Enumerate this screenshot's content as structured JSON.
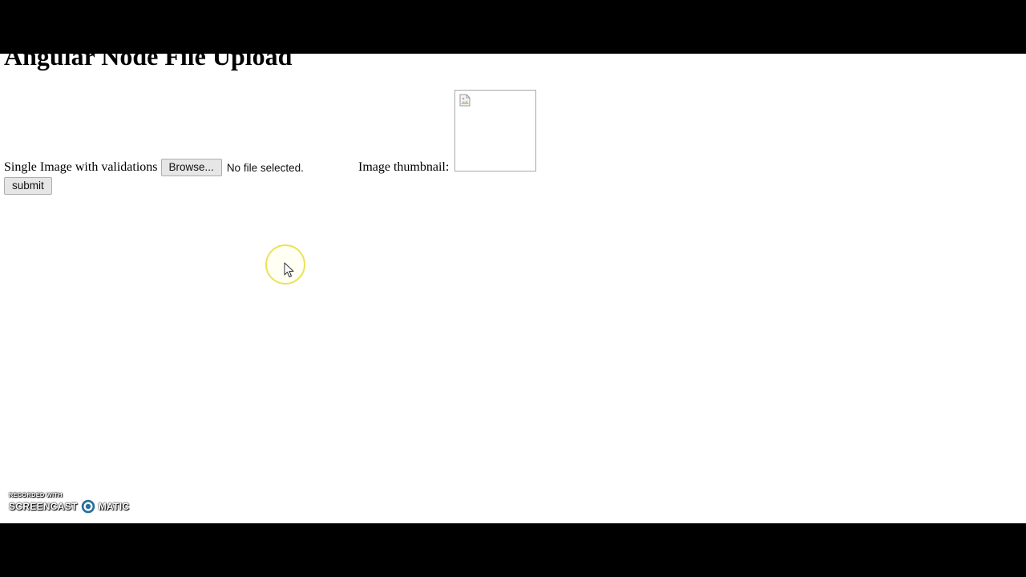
{
  "page": {
    "title": "Angular Node File Upload"
  },
  "upload": {
    "label": "Single Image with validations",
    "browse_label": "Browse...",
    "file_status": "No file selected."
  },
  "thumbnail": {
    "label": "Image thumbnail:"
  },
  "form": {
    "submit_label": "submit"
  },
  "watermark": {
    "line1": "RECORDED WITH",
    "brand_left": "SCREENCAST",
    "brand_right": "MATIC"
  },
  "colors": {
    "letterbox": "#000000",
    "page_background": "#ffffff",
    "button_background": "#e6e6e6",
    "cursor_highlight": "#e8e35a"
  },
  "icons": {
    "thumbnail_placeholder": "broken-image-icon",
    "cursor": "mouse-cursor-icon",
    "watermark_logo": "screencast-o-matic-logo"
  }
}
